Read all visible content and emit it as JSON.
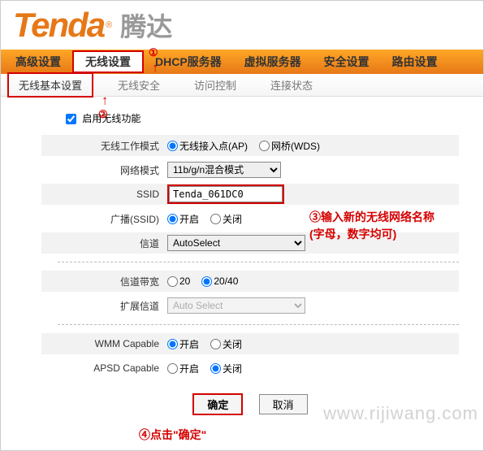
{
  "logo": {
    "brand": "Tenda",
    "cn": "腾达"
  },
  "main_nav": [
    "高级设置",
    "无线设置",
    "DHCP服务器",
    "虚拟服务器",
    "安全设置",
    "路由设置"
  ],
  "main_nav_active": 1,
  "sub_nav": [
    "无线基本设置",
    "无线安全",
    "访问控制",
    "连接状态"
  ],
  "sub_nav_active": 0,
  "enable_label": "启用无线功能",
  "fields": {
    "work_mode": {
      "label": "无线工作模式",
      "opts": [
        "无线接入点(AP)",
        "网桥(WDS)"
      ],
      "selected": 0
    },
    "net_mode": {
      "label": "网络模式",
      "value": "11b/g/n混合模式"
    },
    "ssid": {
      "label": "SSID",
      "value": "Tenda_061DC0"
    },
    "broadcast": {
      "label": "广播(SSID)",
      "opts": [
        "开启",
        "关闭"
      ],
      "selected": 0
    },
    "channel": {
      "label": "信道",
      "value": "AutoSelect"
    },
    "bandwidth": {
      "label": "信道带宽",
      "opts": [
        "20",
        "20/40"
      ],
      "selected": 1
    },
    "ext_channel": {
      "label": "扩展信道",
      "value": "Auto Select"
    },
    "wmm": {
      "label": "WMM Capable",
      "opts": [
        "开启",
        "关闭"
      ],
      "selected": 0
    },
    "apsd": {
      "label": "APSD Capable",
      "opts": [
        "开启",
        "关闭"
      ],
      "selected": 1
    }
  },
  "buttons": {
    "ok": "确定",
    "cancel": "取消"
  },
  "annotations": {
    "a1": "①",
    "a2": "②",
    "a3_line1": "③输入新的无线网络名称",
    "a3_line2": "(字母，数字均可)",
    "a4": "④点击\"确定\""
  },
  "watermark": "www.rijiwang.com"
}
